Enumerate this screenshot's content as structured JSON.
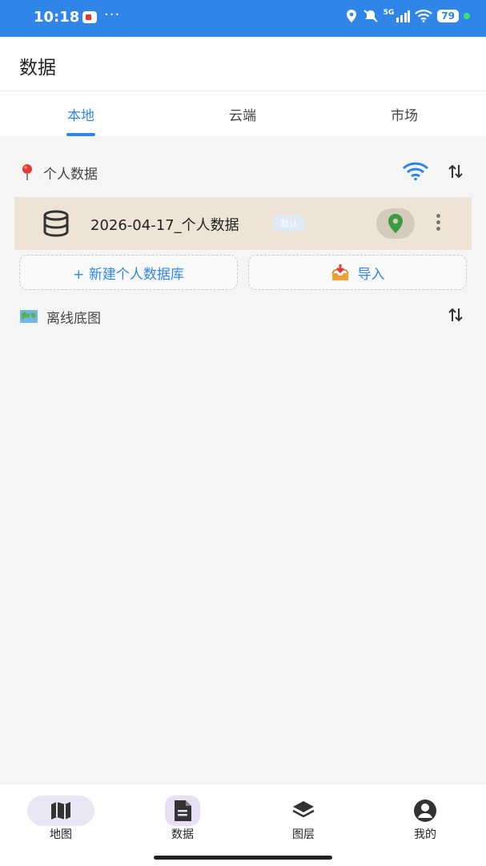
{
  "status_bar": {
    "time": "10:18",
    "dots": "···",
    "network": "5G",
    "battery": "79"
  },
  "header": {
    "title": "数据"
  },
  "tabs": [
    {
      "label": "本地",
      "active": true
    },
    {
      "label": "云端",
      "active": false
    },
    {
      "label": "市场",
      "active": false
    }
  ],
  "personal_section": {
    "label": "个人数据"
  },
  "database_item": {
    "name": "2026-04-17_个人数据",
    "badge": "默认"
  },
  "actions": {
    "new_db": "+ 新建个人数据库",
    "import": "导入"
  },
  "offline_section": {
    "label": "离线底图"
  },
  "bottom_nav": [
    {
      "label": "地图",
      "icon": "map-icon"
    },
    {
      "label": "数据",
      "icon": "data-icon"
    },
    {
      "label": "图层",
      "icon": "layers-icon"
    },
    {
      "label": "我的",
      "icon": "profile-icon"
    }
  ],
  "colors": {
    "accent": "#2f86e6",
    "row_bg": "#efe3d5",
    "pin_green": "#3a9b3f"
  }
}
